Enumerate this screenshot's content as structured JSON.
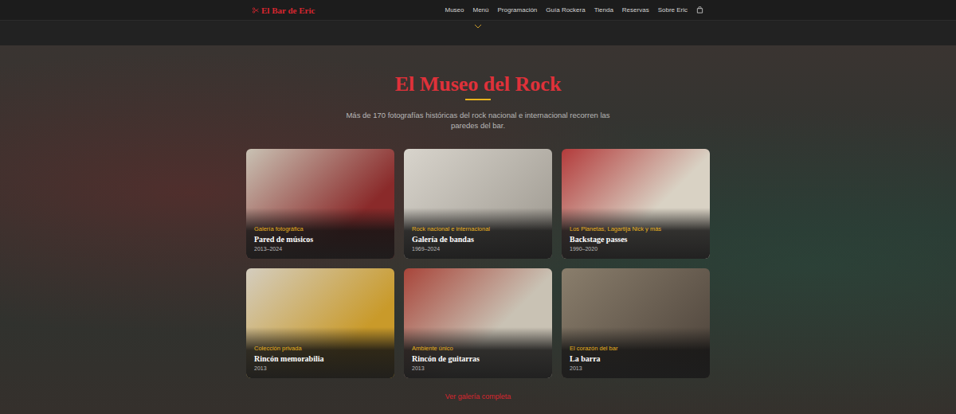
{
  "nav": {
    "logo": "El Bar de Eric",
    "links": [
      {
        "label": "Museo",
        "selected": false
      },
      {
        "label": "Menú",
        "selected": false
      },
      {
        "label": "Programación",
        "selected": false
      },
      {
        "label": "Guía Rockera",
        "selected": false
      },
      {
        "label": "Tienda",
        "selected": false
      },
      {
        "label": "Reservas",
        "selected": false
      },
      {
        "label": "Sobre Eric",
        "selected": false
      }
    ]
  },
  "museum": {
    "title": "El Museo del Rock",
    "subtitle": "Más de 170 fotografías históricas del rock nacional e internacional recorren las paredes del bar.",
    "cards": [
      {
        "category": "Galería fotográfica",
        "title": "Pared de músicos",
        "years": "2013–2024"
      },
      {
        "category": "Rock nacional e internacional",
        "title": "Galería de bandas",
        "years": "1969–2024"
      },
      {
        "category": "Los Planetas, Lagartija Nick y más",
        "title": "Backstage passes",
        "years": "1990–2020"
      },
      {
        "category": "Colección privada",
        "title": "Rincón memorabilia",
        "years": "2013"
      },
      {
        "category": "Ambiente único",
        "title": "Rincón de guitarras",
        "years": "2013"
      },
      {
        "category": "El corazón del bar",
        "title": "La barra",
        "years": "2013"
      }
    ],
    "cta": "Ver galería completa"
  }
}
